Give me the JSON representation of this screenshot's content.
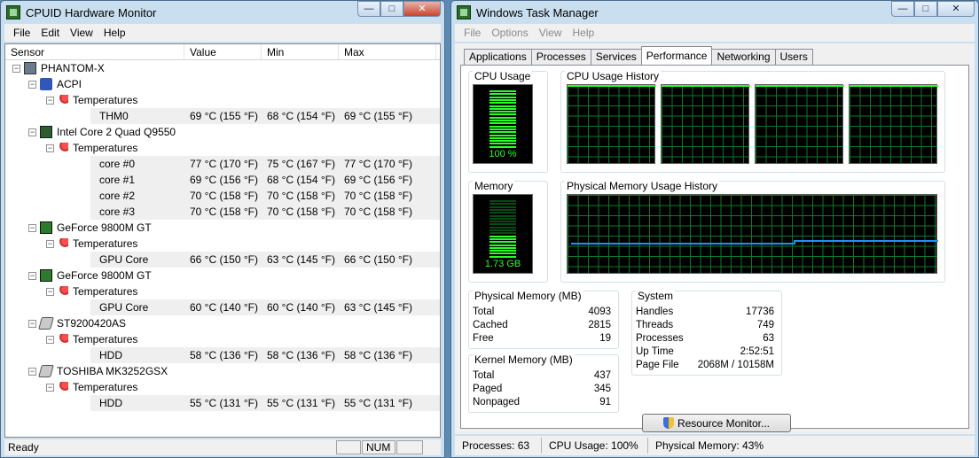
{
  "hm": {
    "title": "CPUID Hardware Monitor",
    "menu": [
      "File",
      "Edit",
      "View",
      "Help"
    ],
    "columns": [
      "Sensor",
      "Value",
      "Min",
      "Max"
    ],
    "rows": [
      {
        "level": 0,
        "icon": "computer-icon",
        "label": "PHANTOM-X"
      },
      {
        "level": 1,
        "icon": "acpi-icon",
        "label": "ACPI"
      },
      {
        "level": 2,
        "icon": "thermometer-icon",
        "label": "Temperatures"
      },
      {
        "level": 3,
        "label": "THM0",
        "value": "69 °C (155 °F)",
        "min": "68 °C (154 °F)",
        "max": "69 °C (155 °F)"
      },
      {
        "level": 1,
        "icon": "cpu-icon",
        "label": "Intel Core 2 Quad Q9550"
      },
      {
        "level": 2,
        "icon": "thermometer-icon",
        "label": "Temperatures"
      },
      {
        "level": 3,
        "label": "core #0",
        "value": "77 °C (170 °F)",
        "min": "75 °C (167 °F)",
        "max": "77 °C (170 °F)"
      },
      {
        "level": 3,
        "label": "core #1",
        "value": "69 °C (156 °F)",
        "min": "68 °C (154 °F)",
        "max": "69 °C (156 °F)"
      },
      {
        "level": 3,
        "label": "core #2",
        "value": "70 °C (158 °F)",
        "min": "70 °C (158 °F)",
        "max": "70 °C (158 °F)"
      },
      {
        "level": 3,
        "label": "core #3",
        "value": "70 °C (158 °F)",
        "min": "70 °C (158 °F)",
        "max": "70 °C (158 °F)"
      },
      {
        "level": 1,
        "icon": "gpu-icon",
        "label": "GeForce 9800M GT"
      },
      {
        "level": 2,
        "icon": "thermometer-icon",
        "label": "Temperatures"
      },
      {
        "level": 3,
        "label": "GPU Core",
        "value": "66 °C (150 °F)",
        "min": "63 °C (145 °F)",
        "max": "66 °C (150 °F)"
      },
      {
        "level": 1,
        "icon": "gpu-icon",
        "label": "GeForce 9800M GT"
      },
      {
        "level": 2,
        "icon": "thermometer-icon",
        "label": "Temperatures"
      },
      {
        "level": 3,
        "label": "GPU Core",
        "value": "60 °C (140 °F)",
        "min": "60 °C (140 °F)",
        "max": "63 °C (145 °F)"
      },
      {
        "level": 1,
        "icon": "hdd-icon",
        "label": "ST9200420AS"
      },
      {
        "level": 2,
        "icon": "thermometer-icon",
        "label": "Temperatures"
      },
      {
        "level": 3,
        "label": "HDD",
        "value": "58 °C (136 °F)",
        "min": "58 °C (136 °F)",
        "max": "58 °C (136 °F)"
      },
      {
        "level": 1,
        "icon": "hdd-icon",
        "label": "TOSHIBA MK3252GSX"
      },
      {
        "level": 2,
        "icon": "thermometer-icon",
        "label": "Temperatures"
      },
      {
        "level": 3,
        "label": "HDD",
        "value": "55 °C (131 °F)",
        "min": "55 °C (131 °F)",
        "max": "55 °C (131 °F)"
      }
    ],
    "status": {
      "text": "Ready",
      "num": "NUM"
    }
  },
  "tm": {
    "title": "Windows Task Manager",
    "menu": [
      "File",
      "Options",
      "View",
      "Help"
    ],
    "tabs": [
      "Applications",
      "Processes",
      "Services",
      "Performance",
      "Networking",
      "Users"
    ],
    "active_tab": "Performance",
    "cpu_usage": {
      "title": "CPU Usage",
      "value": "100 %",
      "level": 1.0
    },
    "cpu_history": {
      "title": "CPU Usage History"
    },
    "memory": {
      "title": "Memory",
      "value": "1.73 GB",
      "level": 0.43
    },
    "mem_history": {
      "title": "Physical Memory Usage History"
    },
    "physical_memory": {
      "title": "Physical Memory (MB)",
      "rows": [
        {
          "k": "Total",
          "v": "4093"
        },
        {
          "k": "Cached",
          "v": "2815"
        },
        {
          "k": "Free",
          "v": "19"
        }
      ]
    },
    "kernel_memory": {
      "title": "Kernel Memory (MB)",
      "rows": [
        {
          "k": "Total",
          "v": "437"
        },
        {
          "k": "Paged",
          "v": "345"
        },
        {
          "k": "Nonpaged",
          "v": "91"
        }
      ]
    },
    "system": {
      "title": "System",
      "rows": [
        {
          "k": "Handles",
          "v": "17736"
        },
        {
          "k": "Threads",
          "v": "749"
        },
        {
          "k": "Processes",
          "v": "63"
        },
        {
          "k": "Up Time",
          "v": "2:52:51"
        },
        {
          "k": "Page File",
          "v": "2068M / 10158M"
        }
      ]
    },
    "resource_button": "Resource Monitor...",
    "status": {
      "processes": "Processes: 63",
      "cpu": "CPU Usage: 100%",
      "mem": "Physical Memory: 43%"
    },
    "colors": {
      "graph_line": "#2aff2a",
      "mem_line": "#1e90ff"
    }
  }
}
